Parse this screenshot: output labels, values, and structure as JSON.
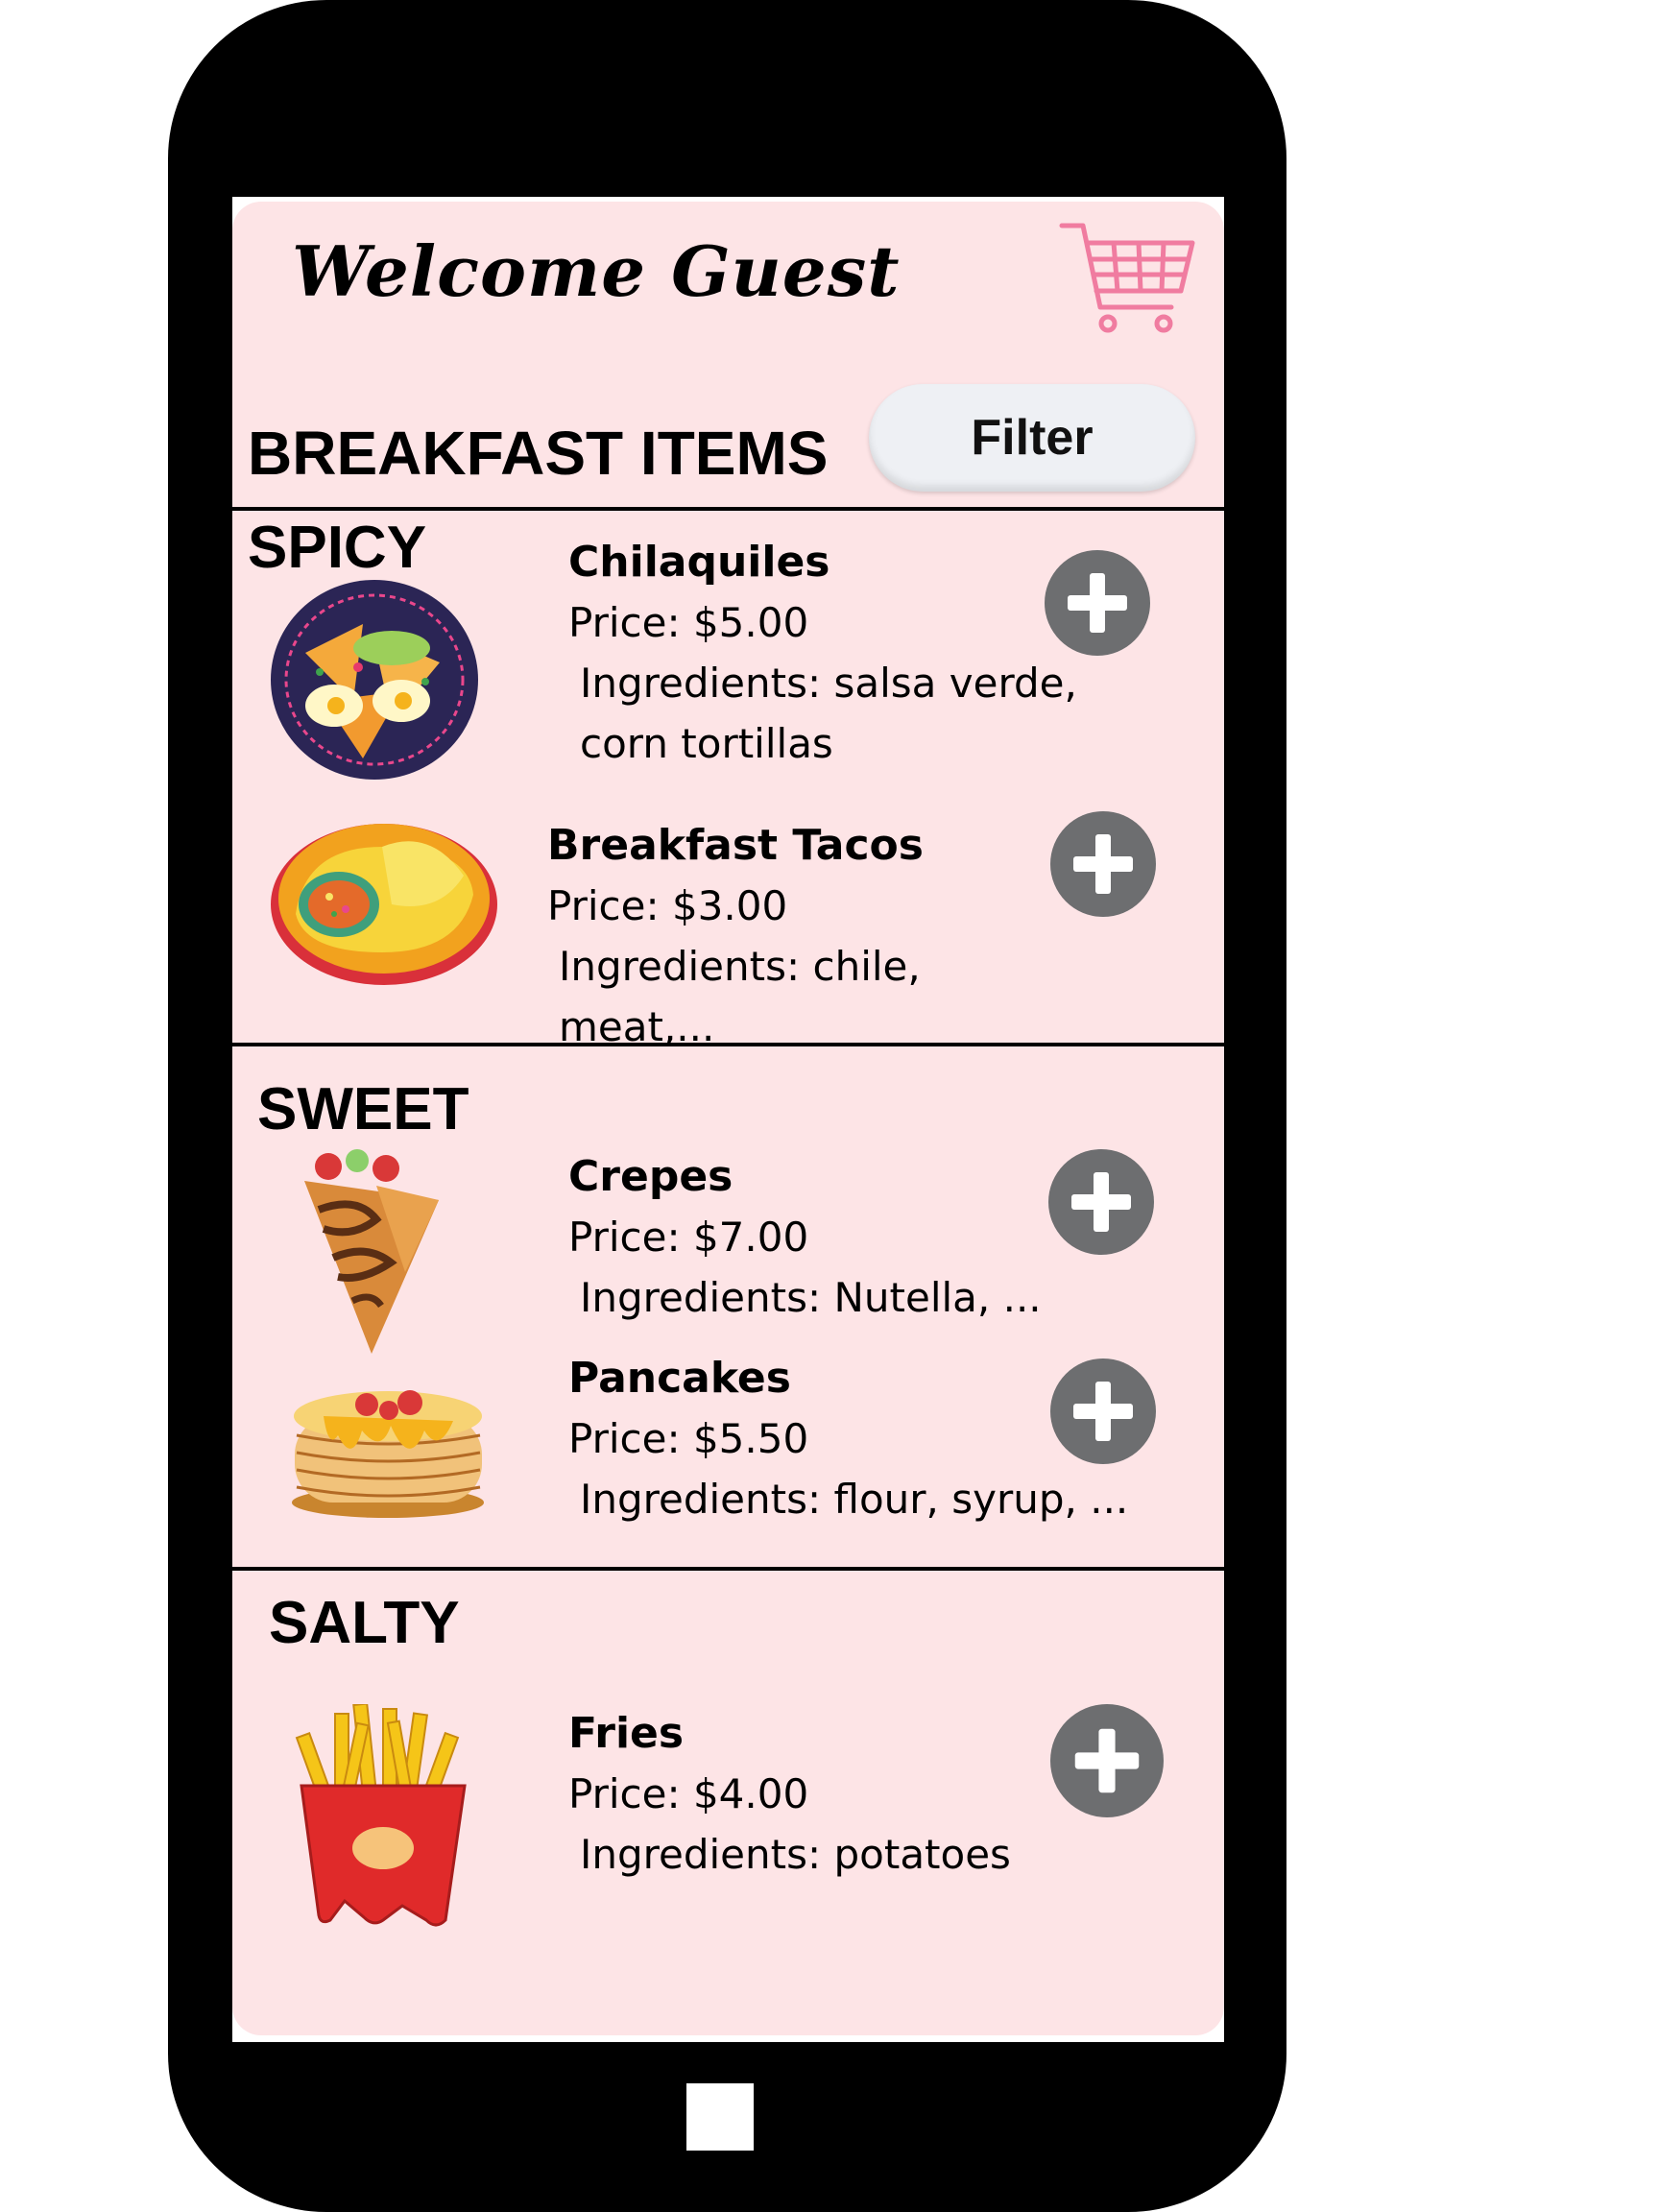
{
  "header": {
    "welcome": "Welcome Guest",
    "cart_icon": "shopping-cart-icon"
  },
  "menu": {
    "title": "BREAKFAST ITEMS",
    "filter_label": "Filter"
  },
  "sections": [
    {
      "label": "SPICY",
      "items": [
        {
          "name": "Chilaquiles",
          "price": "Price: $5.00",
          "ingredients": "Ingredients: salsa verde, corn tortillas"
        },
        {
          "name": "Breakfast Tacos",
          "price": "Price: $3.00",
          "ingredients": "Ingredients: chile, meat,..."
        }
      ]
    },
    {
      "label": "SWEET",
      "items": [
        {
          "name": "Crepes",
          "price": "Price: $7.00",
          "ingredients": "Ingredients: Nutella, ..."
        },
        {
          "name": "Pancakes",
          "price": "Price: $5.50",
          "ingredients": "Ingredients: flour, syrup, ..."
        }
      ]
    },
    {
      "label": "SALTY",
      "items": [
        {
          "name": "Fries",
          "price": "Price: $4.00",
          "ingredients": "Ingredients: potatoes"
        }
      ]
    }
  ],
  "icons": {
    "add": "plus-icon",
    "home": "home-button"
  },
  "colors": {
    "panel_bg": "#fde4e6",
    "cart": "#f07ca0",
    "add_button": "#6d6e70",
    "filter_bg": "#eef0f4"
  }
}
